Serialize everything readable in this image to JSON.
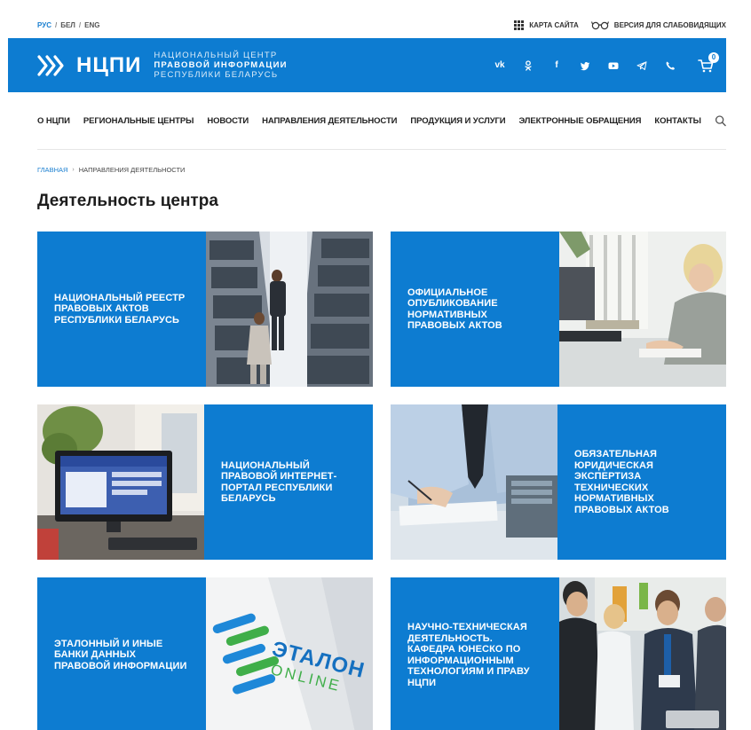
{
  "languages": [
    {
      "label": "РУС",
      "active": true
    },
    {
      "label": "БЕЛ",
      "active": false
    },
    {
      "label": "ENG",
      "active": false
    }
  ],
  "utilities": {
    "sitemap": "Карта сайта",
    "accessibility": "Версия для слабовидящих"
  },
  "header": {
    "logo_text": "НЦПИ",
    "subtitle_line1": "НАЦИОНАЛЬНЫЙ ЦЕНТР",
    "subtitle_line2": "ПРАВОВОЙ ИНФОРМАЦИИ",
    "subtitle_line3": "РЕСПУБЛИКИ БЕЛАРУСЬ",
    "brand_color": "#0d7cd1",
    "socials": [
      "vk-icon",
      "odnoklassniki-icon",
      "facebook-icon",
      "twitter-icon",
      "youtube-icon",
      "telegram-icon",
      "viber-icon"
    ],
    "cart_count": "0"
  },
  "nav": [
    "О НЦПИ",
    "Региональные центры",
    "Новости",
    "Направления деятельности",
    "Продукция и услуги",
    "Электронные обращения",
    "Контакты"
  ],
  "breadcrumb": {
    "home": "Главная",
    "current": "Направления деятельности"
  },
  "page_title": "Деятельность центра",
  "cards": [
    {
      "label": "Национальный реестр правовых актов Республики Беларусь"
    },
    {
      "label": "Официальное опубликование нормативных правовых актов"
    },
    {
      "label": "Национальный правовой интернет-портал Республики Беларусь"
    },
    {
      "label": "Обязательная юридическая экспертиза технических нормативных правовых актов"
    },
    {
      "label": "Эталонный и иные банки данных правовой информации"
    },
    {
      "label": "Научно-техническая деятельность. Кафедра ЮНЕСКО по информационным технологиям и праву НЦПИ"
    }
  ],
  "etalon_logo": {
    "line1": "ЭТАЛОН",
    "line2": "ONLINE"
  }
}
